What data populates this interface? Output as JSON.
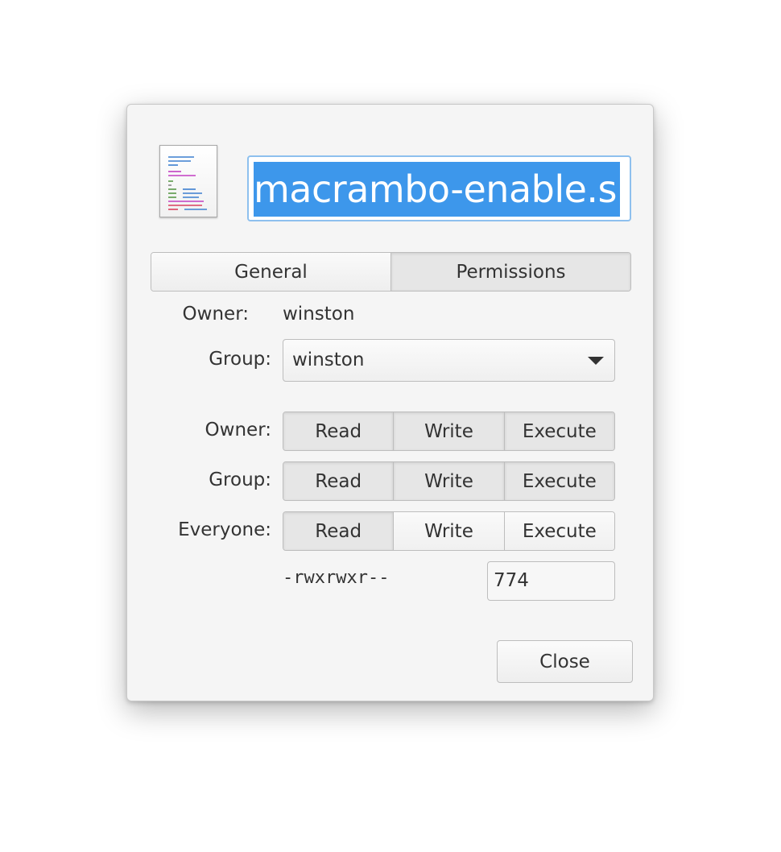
{
  "file": {
    "name": "macrambo-enable.sh",
    "icon": "text-x-script-icon"
  },
  "tabs": [
    {
      "label": "General",
      "active": false
    },
    {
      "label": "Permissions",
      "active": true
    }
  ],
  "ownership": {
    "owner_label": "Owner:",
    "owner_value": "winston",
    "group_label": "Group:",
    "group_value": "winston"
  },
  "permissions": {
    "rows": [
      {
        "label": "Owner:",
        "read": true,
        "write": true,
        "execute": true
      },
      {
        "label": "Group:",
        "read": true,
        "write": true,
        "execute": true
      },
      {
        "label": "Everyone:",
        "read": true,
        "write": false,
        "execute": false
      }
    ],
    "read_label": "Read",
    "write_label": "Write",
    "execute_label": "Execute",
    "mode_string": "-rwxrwxr--",
    "octal": "774"
  },
  "close_label": "Close",
  "colors": {
    "selection": "#3d97eb",
    "focus_border": "#8ec0ee",
    "dialog_bg": "#f5f5f5"
  }
}
